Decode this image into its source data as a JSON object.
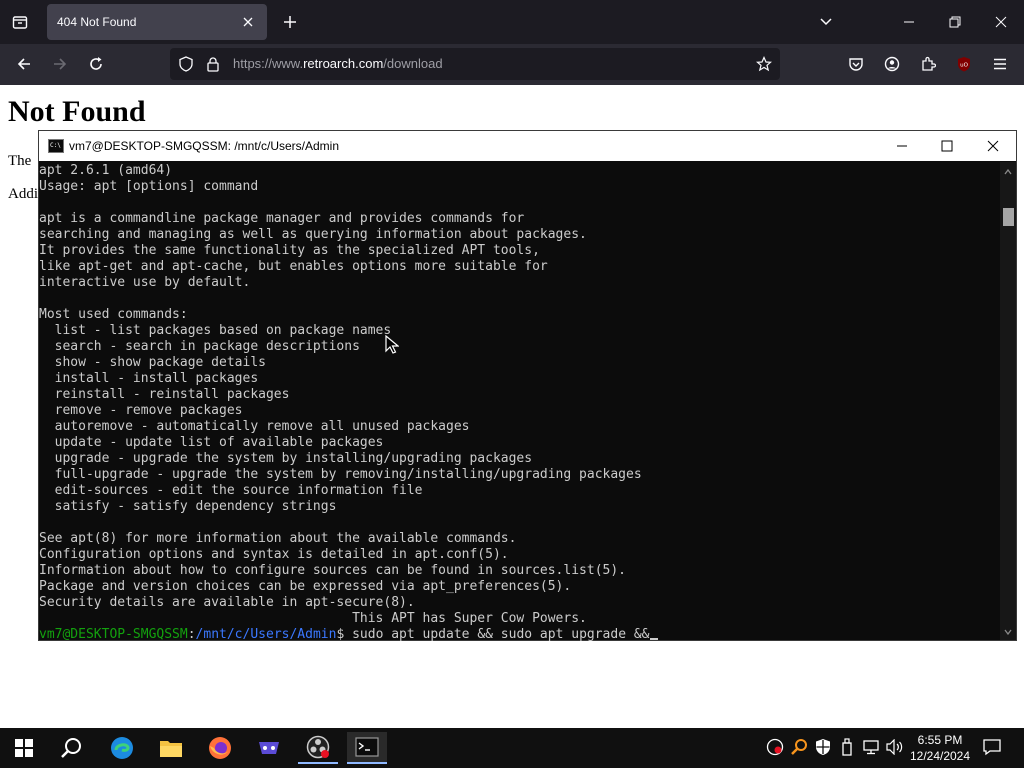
{
  "browser": {
    "tab_title": "404 Not Found",
    "url_prefix": "https://www.",
    "url_host": "retroarch.com",
    "url_path": "/download"
  },
  "page": {
    "heading": "Not Found",
    "para1": "The",
    "para2": "Addi"
  },
  "terminal": {
    "title": "vm7@DESKTOP-SMGQSSM: /mnt/c/Users/Admin",
    "lines": [
      "apt 2.6.1 (amd64)",
      "Usage: apt [options] command",
      "",
      "apt is a commandline package manager and provides commands for",
      "searching and managing as well as querying information about packages.",
      "It provides the same functionality as the specialized APT tools,",
      "like apt-get and apt-cache, but enables options more suitable for",
      "interactive use by default.",
      "",
      "Most used commands:",
      "  list - list packages based on package names",
      "  search - search in package descriptions",
      "  show - show package details",
      "  install - install packages",
      "  reinstall - reinstall packages",
      "  remove - remove packages",
      "  autoremove - automatically remove all unused packages",
      "  update - update list of available packages",
      "  upgrade - upgrade the system by installing/upgrading packages",
      "  full-upgrade - upgrade the system by removing/installing/upgrading packages",
      "  edit-sources - edit the source information file",
      "  satisfy - satisfy dependency strings",
      "",
      "See apt(8) for more information about the available commands.",
      "Configuration options and syntax is detailed in apt.conf(5).",
      "Information about how to configure sources can be found in sources.list(5).",
      "Package and version choices can be expressed via apt_preferences(5).",
      "Security details are available in apt-secure(8).",
      "                                        This APT has Super Cow Powers."
    ],
    "prompt_user": "vm7@DESKTOP-SMGQSSM",
    "prompt_sep": ":",
    "prompt_path": "/mnt/c/Users/Admin",
    "prompt_symbol": "$ ",
    "command": "sudo apt update && sudo apt upgrade &&"
  },
  "taskbar": {
    "time": "6:55 PM",
    "date": "12/24/2024"
  }
}
